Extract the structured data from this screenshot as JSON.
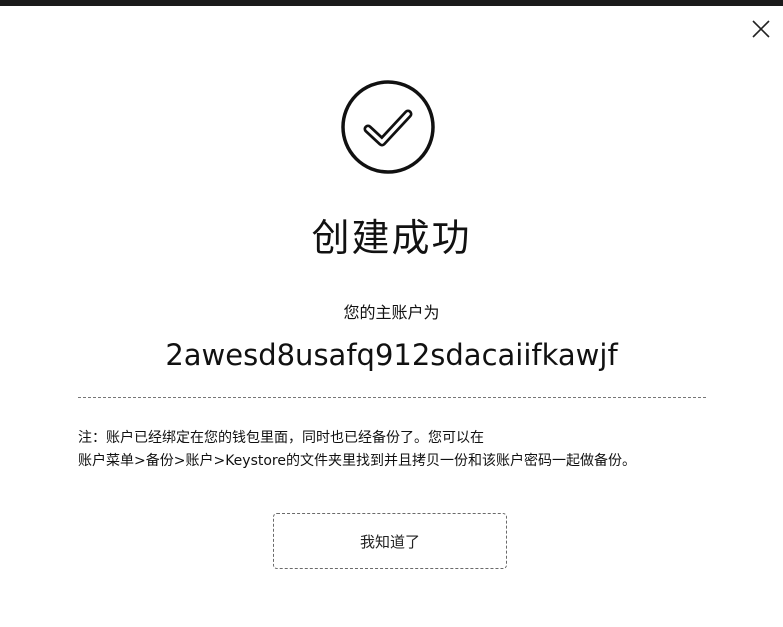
{
  "dialog": {
    "close_icon": "close-icon",
    "success_icon": "check-circle-icon",
    "title": "创建成功",
    "account_label": "您的主账户为",
    "account_id": "2awesd8usafq912sdacaiifkawjf",
    "note_line1": "注：账户已经绑定在您的钱包里面，同时也已经备份了。您可以在",
    "note_line2": "账户菜单>备份>账户>Keystore的文件夹里找到并且拷贝一份和该账户密码一起做备份。",
    "ok_button_label": "我知道了"
  }
}
